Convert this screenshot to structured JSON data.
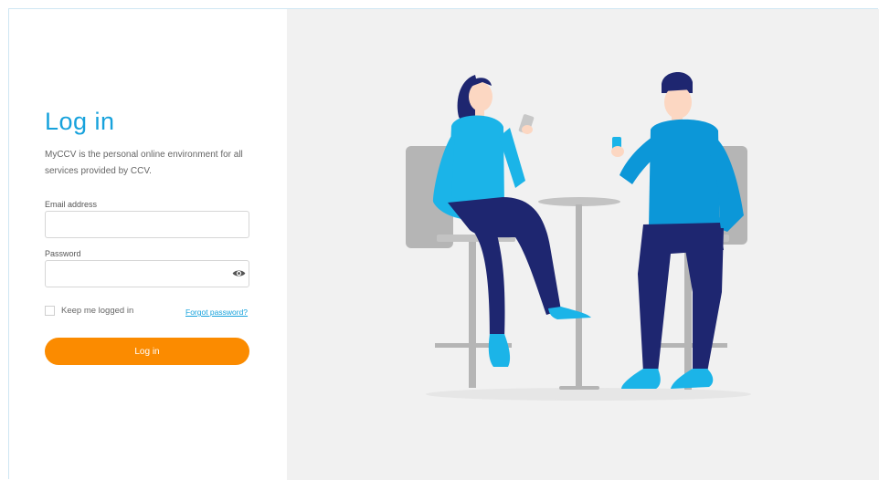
{
  "login": {
    "title": "Log in",
    "intro": "MyCCV is the personal online environment for all services provided by CCV.",
    "email_label": "Email address",
    "email_value": "",
    "password_label": "Password",
    "password_value": "",
    "toggle_icon": "eye-icon",
    "remember_label": "Keep me logged in",
    "remember_checked": false,
    "forgot_label": "Forgot password?",
    "submit_label": "Log in"
  },
  "colors": {
    "accent": "#17a2dc",
    "button": "#fb8b00",
    "illustration_background": "#f1f1f1",
    "sweater_woman": "#1bb4e8",
    "sweater_man": "#0c97d8",
    "trousers": "#1e2670",
    "furniture": "#b5b5b5"
  },
  "illustration": {
    "subject": "two people sitting on bar stools at a round table, each holding a phone"
  }
}
